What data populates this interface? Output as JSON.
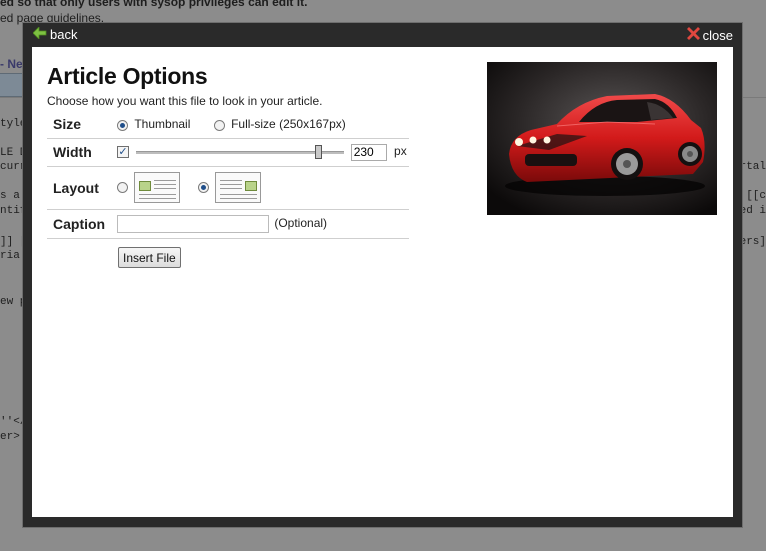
{
  "background": {
    "lines": [
      "ed so that only users with sysop privileges can edit it.",
      "ed page guidelines.",
      "- Nev",
      "tyle=\"",
      "LE DA",
      "curre",
      "s a c",
      "ntifi",
      "]] [",
      "ria.]",
      "ew pa",
      "''</t",
      "er>",
      "ortal",
      "e [[c",
      "ted i",
      "sers]"
    ]
  },
  "dialog": {
    "back_label": "back",
    "close_label": "close",
    "title": "Article Options",
    "subtitle": "Choose how you want this file to look in your article.",
    "size": {
      "label": "Size",
      "options": [
        "Thumbnail",
        "Full-size (250x167px)"
      ],
      "selected": "Thumbnail"
    },
    "width": {
      "label": "Width",
      "checked": true,
      "slider_fraction": 0.89,
      "value": "230",
      "unit": "px"
    },
    "layout": {
      "label": "Layout",
      "selected": "right"
    },
    "caption": {
      "label": "Caption",
      "value": "",
      "hint": "(Optional)"
    },
    "insert_label": "Insert File"
  },
  "colors": {
    "frame": "#2a2a2a",
    "back_arrow": "#7dc142",
    "close_x": "#e0473f",
    "car_red": "#d21a1a"
  }
}
